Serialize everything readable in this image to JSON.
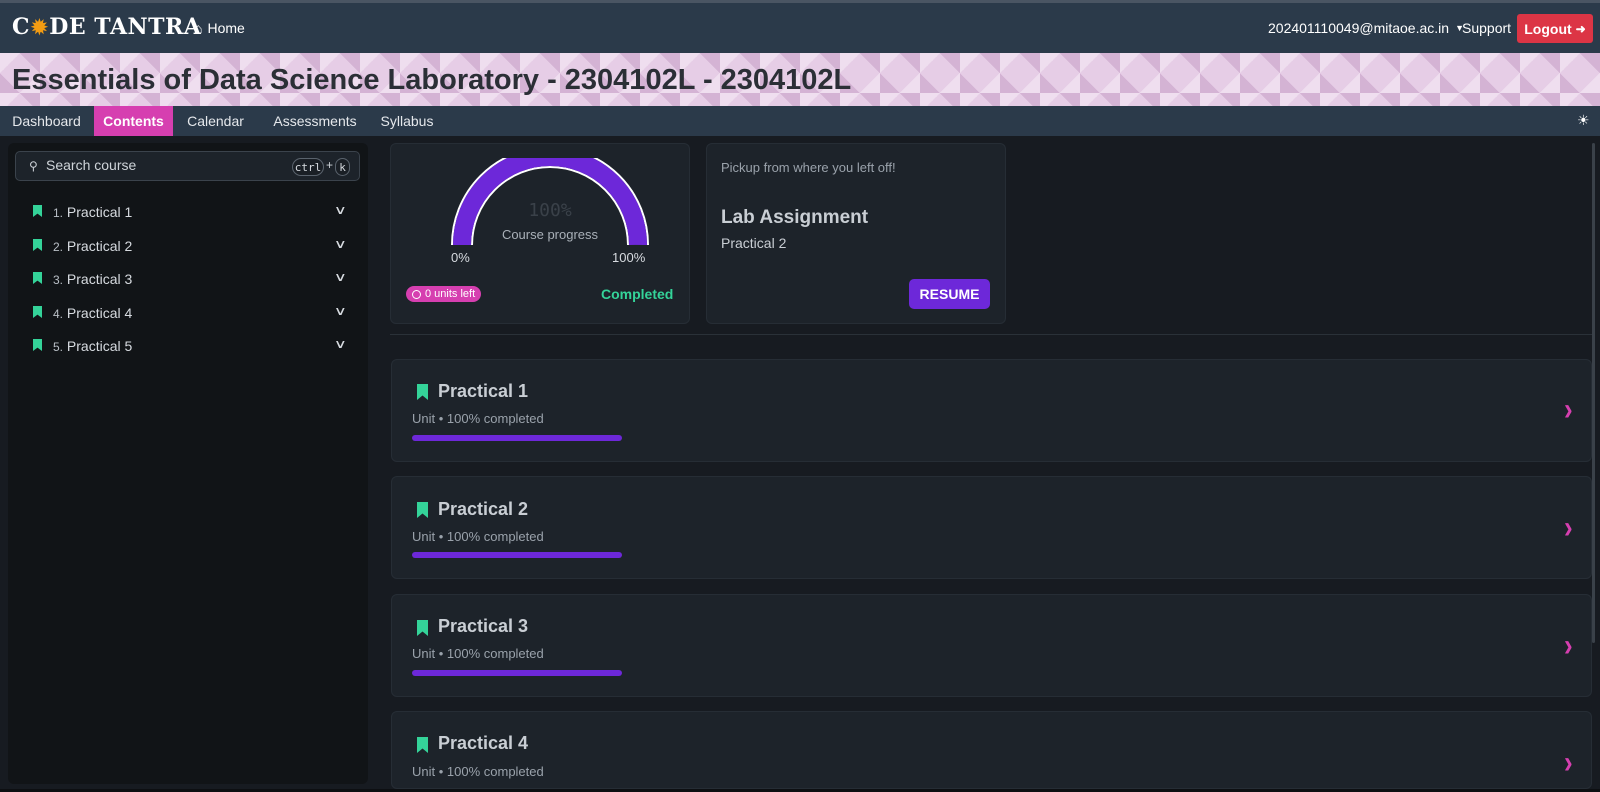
{
  "header": {
    "logo_text": "CODETANTRA",
    "home": "Home",
    "user_email": "202401110049@mitaoe.ac.in",
    "support": "Support",
    "logout": "Logout"
  },
  "course": {
    "title": "Essentials of Data Science Laboratory - 2304102L - 2304102L"
  },
  "tabs": [
    {
      "label": "Dashboard"
    },
    {
      "label": "Contents",
      "active": true
    },
    {
      "label": "Calendar"
    },
    {
      "label": "Assessments"
    },
    {
      "label": "Syllabus"
    }
  ],
  "sidebar": {
    "search_placeholder": "Search course",
    "shortcut_key1": "ctrl",
    "shortcut_plus": "+",
    "shortcut_key2": "k",
    "items": [
      {
        "num": "1.",
        "label": "Practical 1"
      },
      {
        "num": "2.",
        "label": "Practical 2"
      },
      {
        "num": "3.",
        "label": "Practical 3"
      },
      {
        "num": "4.",
        "label": "Practical 4"
      },
      {
        "num": "5.",
        "label": "Practical 5"
      }
    ]
  },
  "progress": {
    "value_percent": 100,
    "value_text": "100%",
    "caption": "Course progress",
    "min_label": "0%",
    "max_label": "100%",
    "units_left": "0 units left",
    "status": "Completed"
  },
  "resume": {
    "hint": "Pickup from where you left off!",
    "title": "Lab Assignment",
    "subtitle": "Practical 2",
    "button": "RESUME"
  },
  "units": [
    {
      "title": "Practical 1",
      "subtitle": "Unit • 100% completed",
      "progress": 1.0
    },
    {
      "title": "Practical 2",
      "subtitle": "Unit • 100% completed",
      "progress": 1.0
    },
    {
      "title": "Practical 3",
      "subtitle": "Unit • 100% completed",
      "progress": 1.0
    },
    {
      "title": "Practical 4",
      "subtitle": "Unit • 100% completed",
      "progress": 1.0
    }
  ],
  "colors": {
    "accent_pink": "#d63fb0",
    "accent_purple": "#6d28d9",
    "success_green": "#34d399",
    "logout_red": "#dc3545"
  },
  "icons": [
    "home-icon",
    "dropdown-caret-icon",
    "logout-icon",
    "theme-toggle-icon",
    "search-icon",
    "bookmark-icon",
    "chevron-down-icon",
    "chevron-right-icon",
    "clock-icon"
  ]
}
